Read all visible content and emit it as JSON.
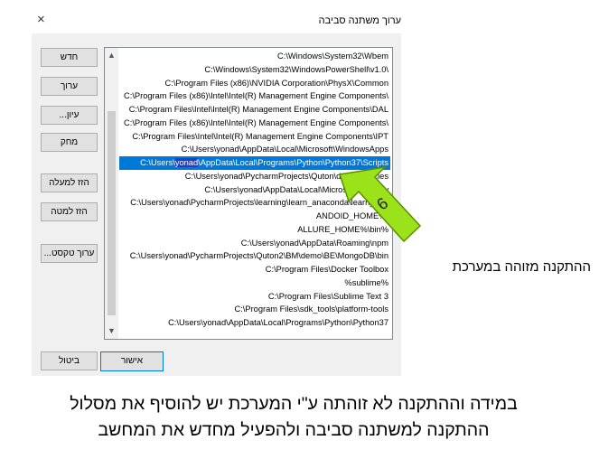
{
  "dialog": {
    "title": "ערוך משתנה סביבה",
    "close_label": "×",
    "buttons": {
      "new": "חדש",
      "edit": "ערוך",
      "browse": "עיון...",
      "delete": "מחק",
      "move_up": "הזז למעלה",
      "move_down": "הזז למטה",
      "edit_text": "ערוך טקסט...",
      "ok": "אישור",
      "cancel": "ביטול"
    },
    "scroll": {
      "up": "▲",
      "down": "▼"
    },
    "paths": [
      "C:\\Windows\\System32\\Wbem",
      "C:\\Windows\\System32\\WindowsPowerShell\\v1.0\\",
      "C:\\Program Files (x86)\\NVIDIA Corporation\\PhysX\\Common",
      "C:\\Program Files (x86)\\Intel\\Intel(R) Management Engine Components\\",
      "C:\\Program Files\\Intel\\Intel(R) Management Engine Components\\DAL",
      "C:\\Program Files (x86)\\Intel\\Intel(R) Management Engine Components\\",
      "C:\\Program Files\\Intel\\Intel(R) Management Engine Components\\IPT",
      "C:\\Users\\yonad\\AppData\\Local\\Microsoft\\WindowsApps",
      "",
      "C:\\Users\\yonad\\PycharmProjects\\Quton\\dependencies",
      "C:\\Users\\yonad\\AppData\\Local\\Microsoft\\Window",
      "C:\\Users\\yonad\\PycharmProjects\\learning\\learn_anaconda\\learn_m...",
      "ANDOID_HOME%\\",
      "ALLURE_HOME%\\bin%",
      "C:\\Users\\yonad\\AppData\\Roaming\\npm",
      "C:\\Users\\yonad\\PycharmProjects\\Quton2\\BM\\demo\\BE\\MongoDB\\bin",
      "C:\\Program Files\\Docker Toolbox",
      "%sublime%",
      "C:\\Program Files\\Sublime Text 3",
      "C:\\Program Files\\sdk_tools\\platform-tools",
      "C:\\Users\\yonad\\AppData\\Local\\Programs\\Python\\Python37"
    ],
    "selected_path": {
      "prefix": "C:\\Users\\",
      "highlight": "yonad",
      "suffix": "\\AppData\\Local\\Programs\\Python\\Python37\\Scripts"
    }
  },
  "annotation": {
    "number": "6",
    "color": "#9be21a"
  },
  "notes": {
    "side": "ההתקנה מזוהה במערכת",
    "bottom_line1": "במידה וההתקנה לא זוהתה ע\"י המערכת יש להוסיף את מסלול",
    "bottom_line2": "ההתקנה למשתנה סביבה ולהפעיל מחדש את המחשב"
  }
}
